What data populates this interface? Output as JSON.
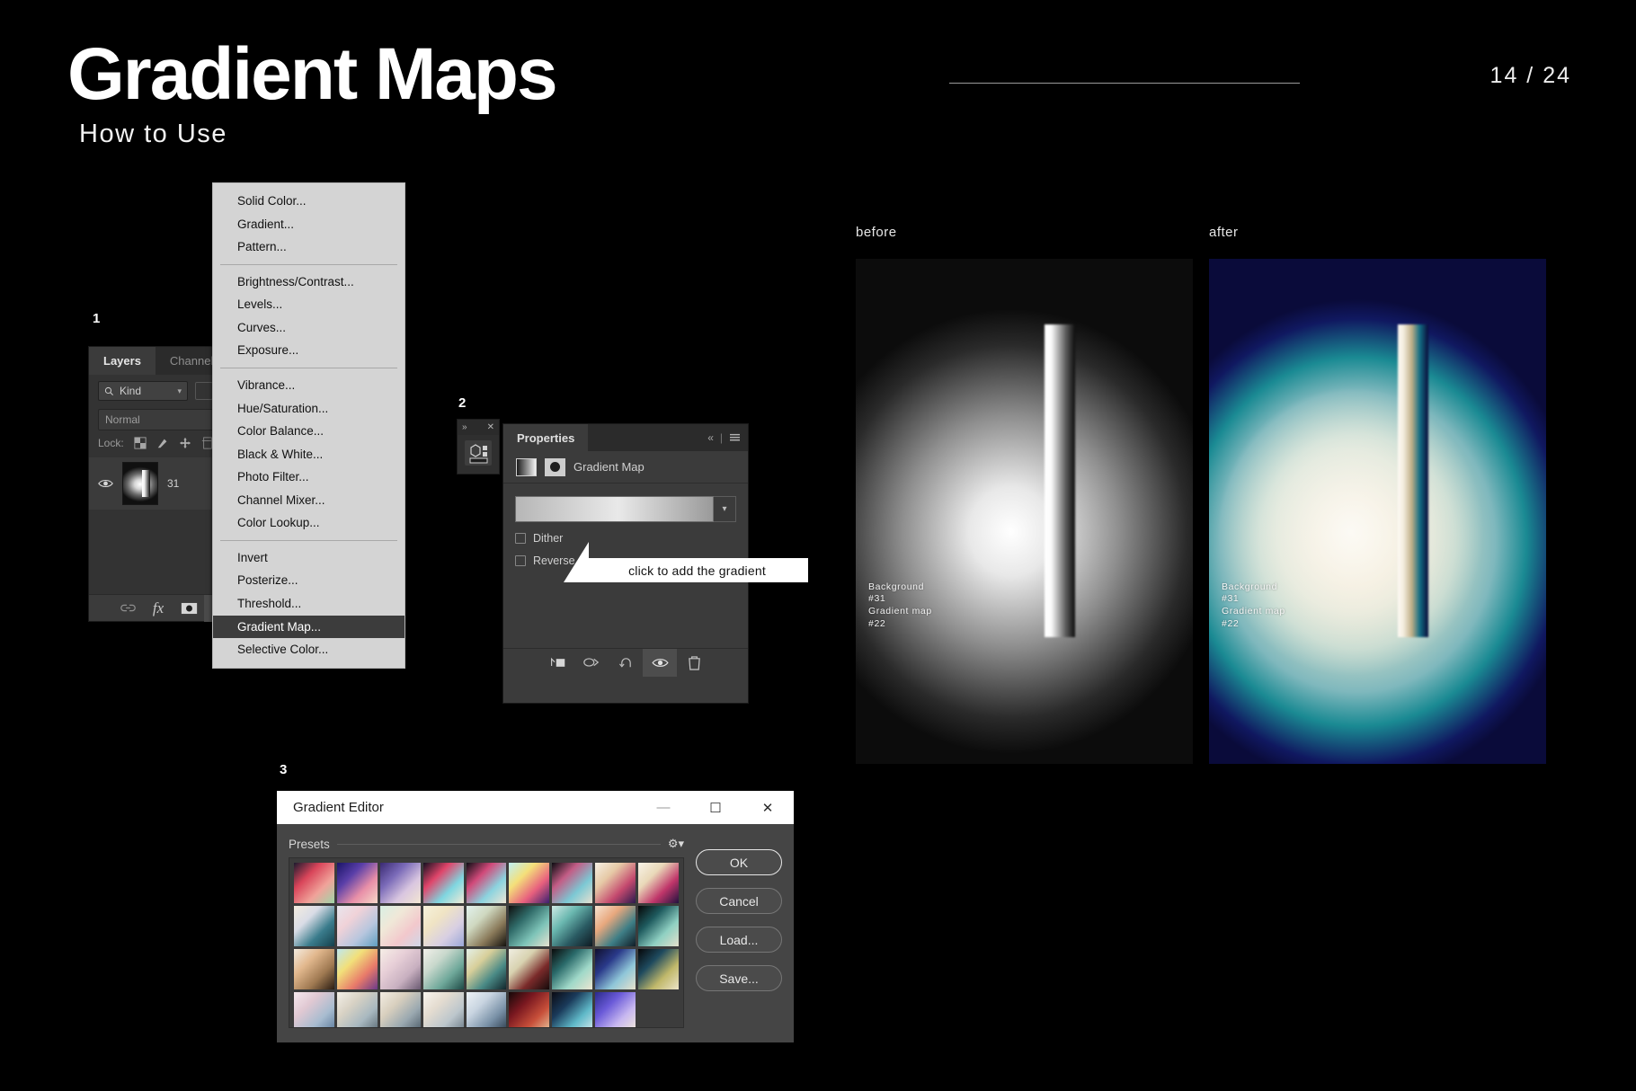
{
  "slide": {
    "title": "Gradient Maps",
    "subtitle": "How to Use",
    "page_indicator": "14 / 24",
    "background_color": "#000000"
  },
  "steps": {
    "one": "1",
    "two": "2",
    "three": "3"
  },
  "layers_panel": {
    "tabs": [
      {
        "label": "Layers",
        "active": true
      },
      {
        "label": "Channels",
        "active": false
      }
    ],
    "filter_kind": "Kind",
    "blend_mode": "Normal",
    "lock_label": "Lock:",
    "layer": {
      "name": "31",
      "visible": true
    },
    "footer_icons": [
      "link-icon",
      "fx-icon",
      "add-mask-icon",
      "adjustment-layer-icon",
      "new-group-icon",
      "new-layer-icon",
      "delete-layer-icon"
    ]
  },
  "adjustment_menu": {
    "groups": [
      {
        "items": [
          "Solid Color...",
          "Gradient...",
          "Pattern..."
        ]
      },
      {
        "items": [
          "Brightness/Contrast...",
          "Levels...",
          "Curves...",
          "Exposure..."
        ]
      },
      {
        "items": [
          "Vibrance...",
          "Hue/Saturation...",
          "Color Balance...",
          "Black & White...",
          "Photo Filter...",
          "Channel Mixer...",
          "Color Lookup..."
        ]
      },
      {
        "items": [
          "Invert",
          "Posterize...",
          "Threshold...",
          "Gradient Map...",
          "Selective Color..."
        ]
      }
    ],
    "highlighted": "Gradient Map..."
  },
  "properties_panel": {
    "tab_label": "Properties",
    "adjustment_title": "Gradient Map",
    "checkboxes": [
      {
        "label": "Dither",
        "checked": false
      },
      {
        "label": "Reverse",
        "checked": false
      }
    ],
    "collapse_icon": "double-chevron-left-icon",
    "menu_icon": "panel-menu-icon",
    "footer_icons": [
      "clip-to-layer-icon",
      "previous-state-icon",
      "reset-icon",
      "toggle-visibility-icon",
      "delete-icon"
    ]
  },
  "callout": {
    "text": "click to add the gradient"
  },
  "gradient_editor": {
    "window_title": "Gradient Editor",
    "window_buttons": [
      "minimize-icon",
      "maximize-icon",
      "close-icon"
    ],
    "presets_label": "Presets",
    "gear_icon": "gear-icon",
    "buttons": [
      {
        "label": "OK",
        "primary": true
      },
      {
        "label": "Cancel",
        "primary": false
      },
      {
        "label": "Load...",
        "primary": false
      },
      {
        "label": "Save...",
        "primary": false
      }
    ],
    "preset_count": 35,
    "preset_columns": 9,
    "preset_gradients": [
      [
        "#1c1a2e",
        "#d9455a",
        "#f0a39a",
        "#9fd6a8"
      ],
      [
        "#1a1468",
        "#5a3fa8",
        "#e88fa8",
        "#f6d9c8"
      ],
      [
        "#3a2a72",
        "#7a6ab8",
        "#d9c6e0",
        "#f3e6d2"
      ],
      [
        "#141020",
        "#e0456a",
        "#7fd6e0",
        "#f2ead6"
      ],
      [
        "#0d0d14",
        "#d14a7a",
        "#8bd3df",
        "#efe6d4"
      ],
      [
        "#bff0f5",
        "#f4e07a",
        "#e8607e",
        "#3a2070"
      ],
      [
        "#0b0b10",
        "#c35d86",
        "#7cc8d4",
        "#e8e0cf"
      ],
      [
        "#f6f0e4",
        "#e6c9a6",
        "#c4496e",
        "#2a1a4e"
      ],
      [
        "#f8f3e8",
        "#e9d8b8",
        "#c0366a",
        "#20123f"
      ],
      [
        "#f4ede0",
        "#d9dce6",
        "#3a7c8c",
        "#14404c"
      ],
      [
        "#e8e6ee",
        "#f0d2d8",
        "#b8c6de",
        "#5f9fc0"
      ],
      [
        "#d8f0e4",
        "#f0e8d8",
        "#f2c8cc",
        "#cfd6e8"
      ],
      [
        "#f6f2dc",
        "#f0e4c4",
        "#d8cfe2",
        "#9aa6d8"
      ],
      [
        "#e2f2ee",
        "#cfd8c0",
        "#8a7a5a",
        "#14120e"
      ],
      [
        "#0e0e0e",
        "#2f6a68",
        "#7ec4b8",
        "#e6e2d0"
      ],
      [
        "#cfeae6",
        "#6bb8b0",
        "#2a5a62",
        "#0e1a22"
      ],
      [
        "#f7e4d2",
        "#e8a87e",
        "#3e7e86",
        "#101c26"
      ],
      [
        "#060606",
        "#1e5a5e",
        "#8fd0c2",
        "#e4e0cc"
      ],
      [
        "#f4ece0",
        "#e2b88e",
        "#a07a52",
        "#2a1c12"
      ],
      [
        "#bfe8f0",
        "#f2e07a",
        "#e87a6a",
        "#6a3a8a"
      ],
      [
        "#f6eee6",
        "#e8d0d8",
        "#c8b0c0",
        "#6a5a72"
      ],
      [
        "#f2f0ea",
        "#c8d8cc",
        "#6fa89a",
        "#1e4a46"
      ],
      [
        "#e4f0e8",
        "#d8cf9a",
        "#4a8a86",
        "#12262c"
      ],
      [
        "#f0eee2",
        "#d8d2b0",
        "#7a2a2a",
        "#140a0a"
      ],
      [
        "#0a0a0a",
        "#2a6a6a",
        "#9fd8c8",
        "#ece6d2"
      ],
      [
        "#10102e",
        "#2a3a8a",
        "#8fc6d8",
        "#e8e2cc"
      ],
      [
        "#060608",
        "#1e4a5e",
        "#c0b86a",
        "#ece4c8"
      ],
      [
        "#f6e8ee",
        "#e0c8d2",
        "#a8bcd0",
        "#5a7a9a"
      ],
      [
        "#f4f0e8",
        "#d8d2c4",
        "#a8b8c0",
        "#5a6a74"
      ],
      [
        "#f2ece2",
        "#d8cfbe",
        "#9aa8b0",
        "#4a5a66"
      ],
      [
        "#f8f4ee",
        "#e4dcd0",
        "#bcc6cc",
        "#6a7a86"
      ],
      [
        "#eef2f6",
        "#c8d4e0",
        "#7a92a8",
        "#2a3a4a"
      ],
      [
        "#140808",
        "#7a1820",
        "#c8503a",
        "#e8c8a0"
      ],
      [
        "#0a0a12",
        "#1a3a5a",
        "#5fb8c8",
        "#d8ecee"
      ],
      [
        "#2a2a8a",
        "#6a5ad8",
        "#c8b8f0",
        "#f4ecd8"
      ]
    ]
  },
  "comparison": {
    "before_label": "before",
    "after_label": "after",
    "watermark": {
      "line1": "Background",
      "line2": "#31",
      "line3": "Gradient map",
      "line4": "#22"
    }
  }
}
